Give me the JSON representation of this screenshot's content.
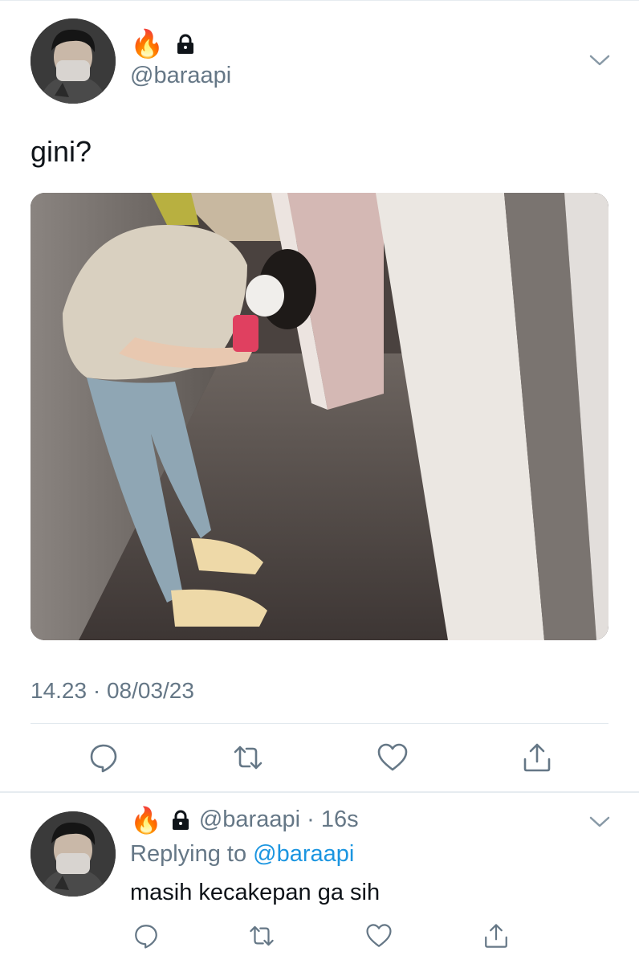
{
  "tweet": {
    "author_handle": "@baraapi",
    "text": "gini?",
    "timestamp": "14.23 · 08/03/23",
    "badge_emoji": "🔥",
    "icons": {
      "verified_badge": "fire-emoji",
      "protected": "lock-icon",
      "menu": "chevron-down-icon"
    }
  },
  "reply": {
    "author_handle": "@baraapi",
    "age": "16s",
    "replying_to_label": "Replying to",
    "replying_to_handle": "@baraapi",
    "text": "masih kecakepan ga sih",
    "badge_emoji": "🔥"
  },
  "actions": [
    "reply-icon",
    "retweet-icon",
    "like-icon",
    "share-icon"
  ],
  "colors": {
    "text": "#0f1419",
    "secondary": "#657786",
    "link": "#1b95e0",
    "divider": "#e1e8ed"
  }
}
